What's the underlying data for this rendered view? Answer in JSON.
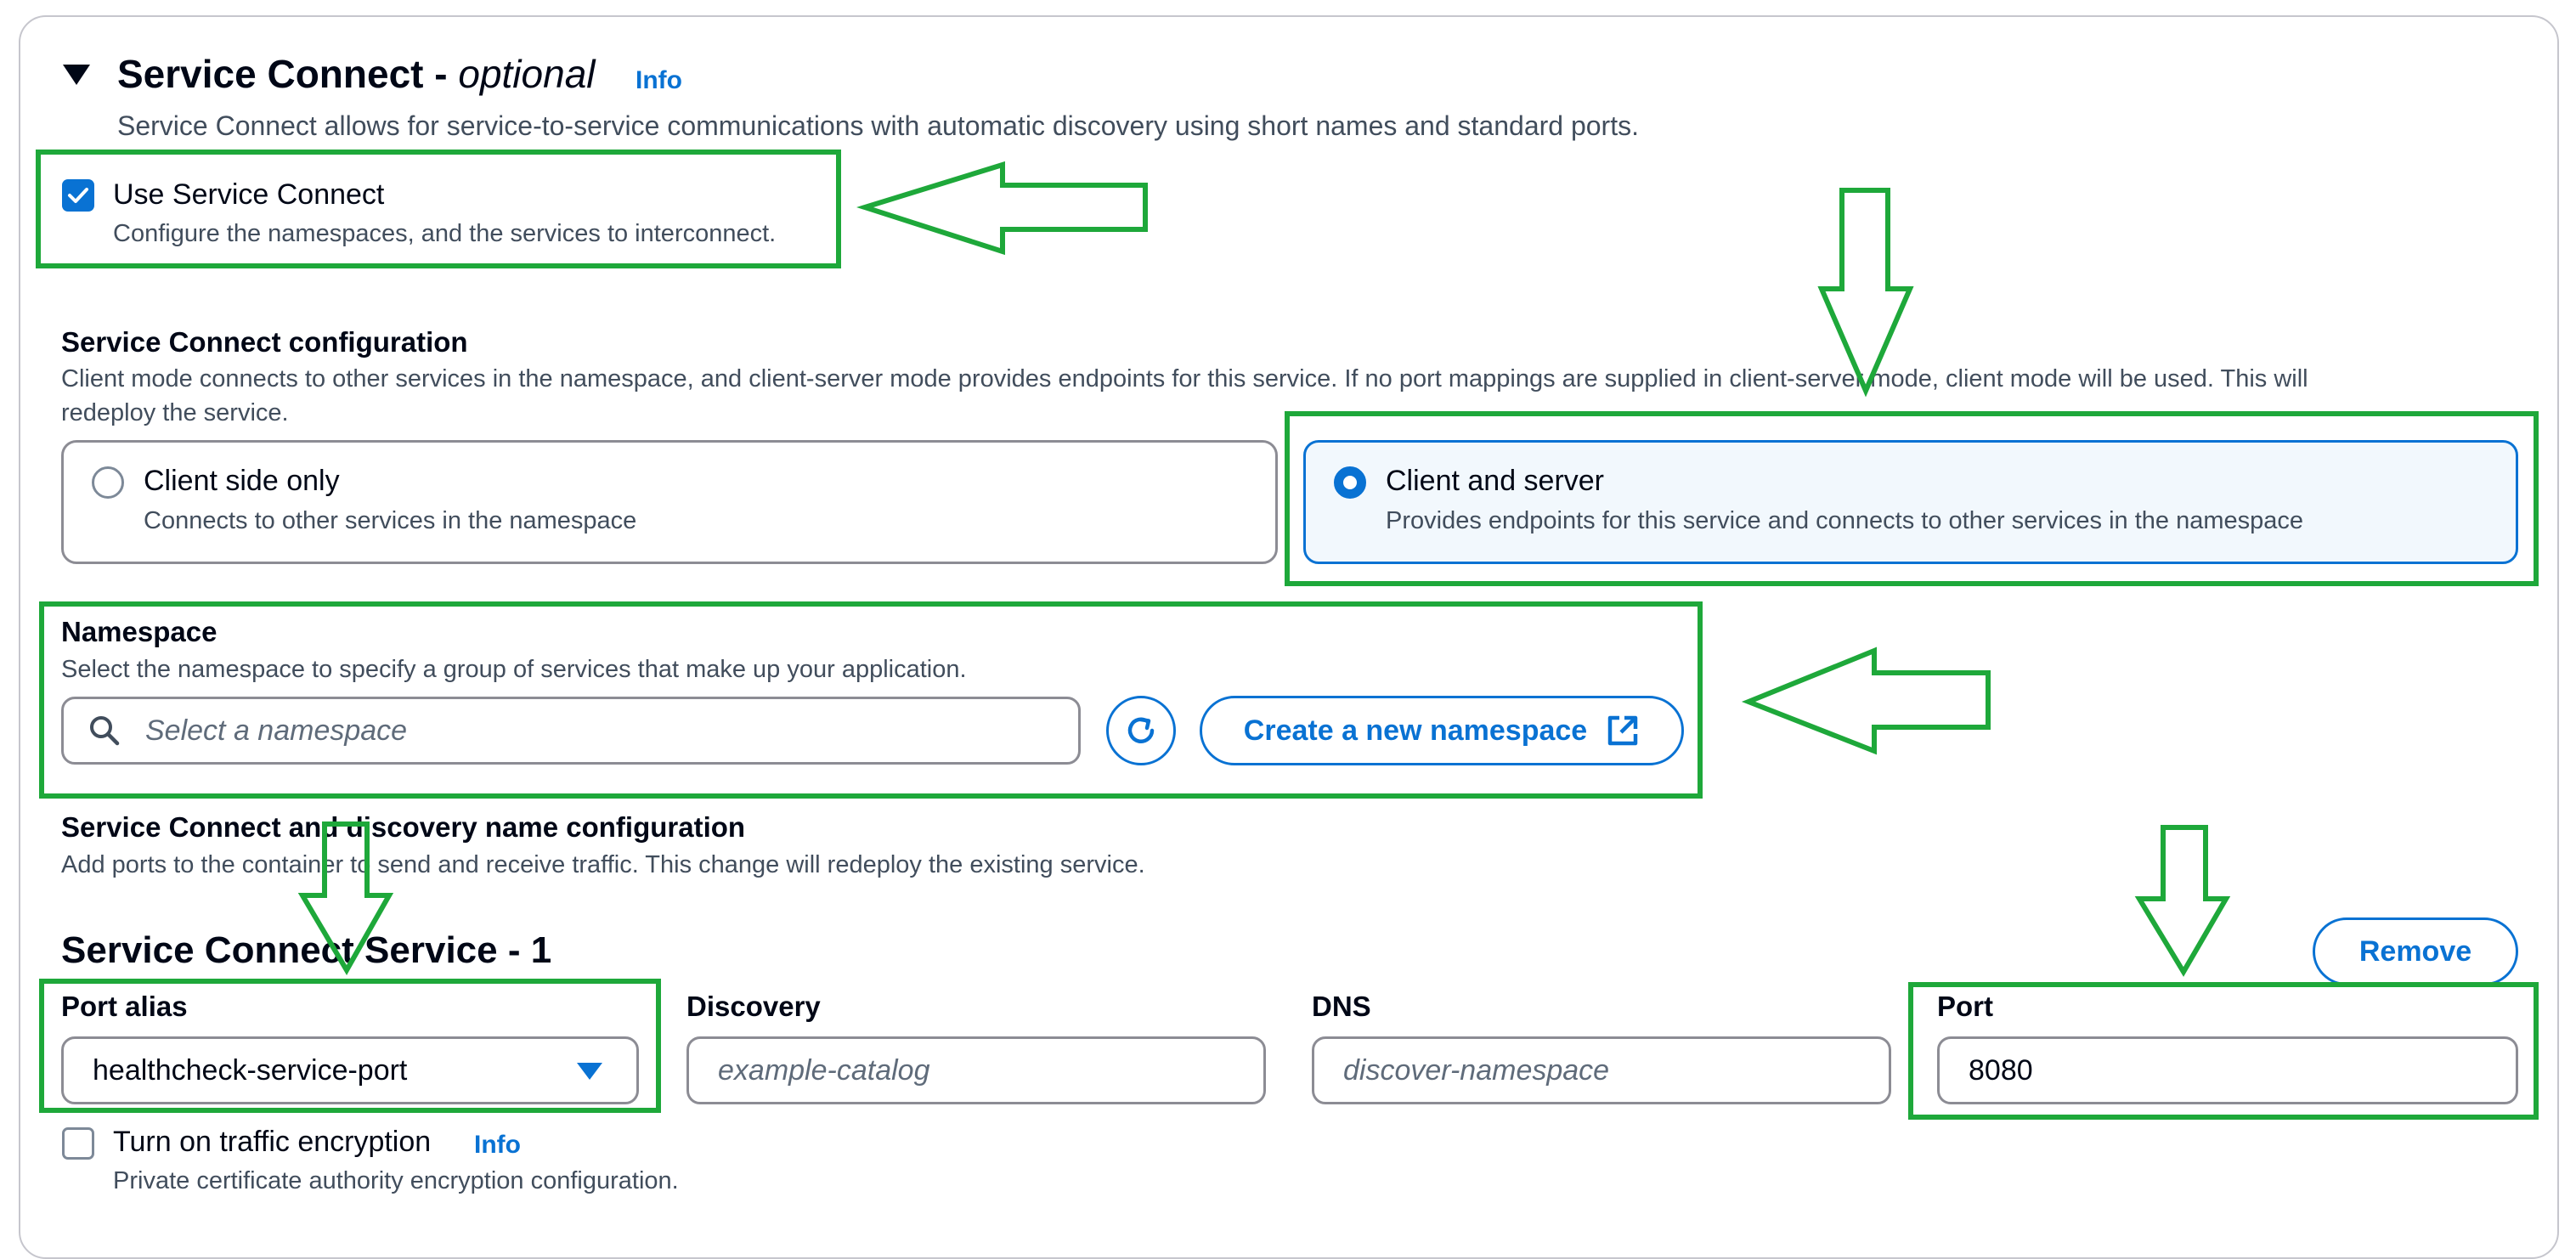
{
  "section": {
    "title": "Service Connect - ",
    "title_optional": "optional",
    "info": "Info",
    "description": "Service Connect allows for service-to-service communications with automatic discovery using short names and standard ports."
  },
  "use_service_connect": {
    "label": "Use Service Connect",
    "description": "Configure the namespaces, and the services to interconnect.",
    "checked": true
  },
  "config": {
    "label": "Service Connect configuration",
    "description_line1": "Client mode connects to other services in the namespace, and client-server mode provides endpoints for this service. If no port mappings are supplied in client-server mode, client mode will be used. This will",
    "description_line2": "redeploy the service.",
    "options": [
      {
        "label": "Client side only",
        "description": "Connects to other services in the namespace",
        "selected": false
      },
      {
        "label": "Client and server",
        "description": "Provides endpoints for this service and connects to other services in the namespace",
        "selected": true
      }
    ]
  },
  "namespace": {
    "label": "Namespace",
    "description": "Select the namespace to specify a group of services that make up your application.",
    "placeholder": "Select a namespace",
    "create_button": "Create a new namespace"
  },
  "discovery_config": {
    "label": "Service Connect and discovery name configuration",
    "description": "Add ports to the container to send and receive traffic. This change will redeploy the existing service."
  },
  "service": {
    "title": "Service Connect Service - 1",
    "remove_button": "Remove",
    "port_alias": {
      "label": "Port alias",
      "value": "healthcheck-service-port"
    },
    "discovery": {
      "label": "Discovery",
      "placeholder": "example-catalog"
    },
    "dns": {
      "label": "DNS",
      "placeholder": "discover-namespace"
    },
    "port": {
      "label": "Port",
      "value": "8080"
    }
  },
  "encryption": {
    "label": "Turn on traffic encryption",
    "info": "Info",
    "description": "Private certificate authority encryption configuration.",
    "checked": false
  },
  "colors": {
    "accent": "#0972d3",
    "annotation": "#1ea83a",
    "selected_tile_bg": "#f2f8fd"
  }
}
